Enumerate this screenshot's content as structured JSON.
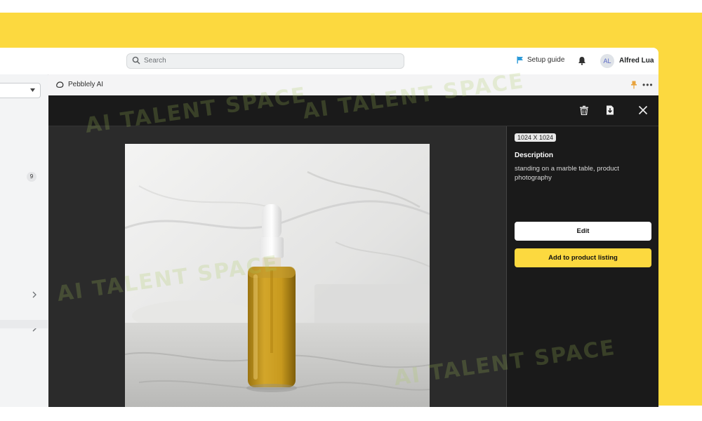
{
  "colors": {
    "brand_yellow": "#fcd93f",
    "viewer_bg": "#1e1f20",
    "panel_bg": "#1a1a1a",
    "flag": "#2c9ad8"
  },
  "topbar": {
    "search_placeholder": "Search",
    "setup_guide_label": "Setup guide",
    "avatar_initials": "AL",
    "user_name": "Alfred Lua"
  },
  "sidebar": {
    "count": "9"
  },
  "app_header": {
    "title": "Pebblely AI"
  },
  "viewer": {
    "toolbar_icons": [
      "trash-icon",
      "download-icon",
      "close-icon"
    ],
    "image_size": "1024 X 1024",
    "description_heading": "Description",
    "description_text": "standing on a marble table, product photography",
    "edit_button": "Edit",
    "add_button": "Add to product listing"
  },
  "watermark": {
    "text": "AI TALENT SPACE"
  }
}
